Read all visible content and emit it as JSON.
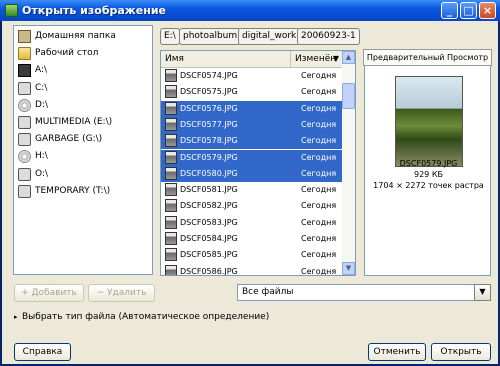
{
  "window": {
    "title": "Открыть изображение"
  },
  "places": [
    {
      "label": "Домашняя папка",
      "icon": "home-folder-icon"
    },
    {
      "label": "Рабочий стол",
      "icon": "desktop-folder-icon"
    },
    {
      "label": "A:\\",
      "icon": "floppy-icon"
    },
    {
      "label": "C:\\",
      "icon": "hard-disk-icon"
    },
    {
      "label": "D:\\",
      "icon": "cdrom-icon"
    },
    {
      "label": "MULTIMEDIA (E:\\)",
      "icon": "hard-disk-icon"
    },
    {
      "label": "GARBAGE (G:\\)",
      "icon": "hard-disk-icon"
    },
    {
      "label": "H:\\",
      "icon": "cdrom-icon"
    },
    {
      "label": "O:\\",
      "icon": "hard-disk-icon"
    },
    {
      "label": "TEMPORARY (T:\\)",
      "icon": "hard-disk-icon"
    }
  ],
  "path": [
    "E:\\",
    "photoalbum",
    "digital_work",
    "20060923-1"
  ],
  "files": {
    "header_name": "Имя",
    "header_modified": "Изменён",
    "rows": [
      {
        "name": "DSCF0574.JPG",
        "date": "Сегодня",
        "selected": false
      },
      {
        "name": "DSCF0575.JPG",
        "date": "Сегодня",
        "selected": false
      },
      {
        "name": "DSCF0576.JPG",
        "date": "Сегодня",
        "selected": true
      },
      {
        "name": "DSCF0577.JPG",
        "date": "Сегодня",
        "selected": true
      },
      {
        "name": "DSCF0578.JPG",
        "date": "Сегодня",
        "selected": true
      },
      {
        "name": "DSCF0579.JPG",
        "date": "Сегодня",
        "selected": true
      },
      {
        "name": "DSCF0580.JPG",
        "date": "Сегодня",
        "selected": true
      },
      {
        "name": "DSCF0581.JPG",
        "date": "Сегодня",
        "selected": false
      },
      {
        "name": "DSCF0582.JPG",
        "date": "Сегодня",
        "selected": false
      },
      {
        "name": "DSCF0583.JPG",
        "date": "Сегодня",
        "selected": false
      },
      {
        "name": "DSCF0584.JPG",
        "date": "Сегодня",
        "selected": false
      },
      {
        "name": "DSCF0585.JPG",
        "date": "Сегодня",
        "selected": false
      },
      {
        "name": "DSCF0586.JPG",
        "date": "Сегодня",
        "selected": false
      }
    ]
  },
  "preview": {
    "title": "Предварительный Просмотр",
    "filename": "DSCF0579.JPG",
    "size": "929 КБ",
    "dimensions": "1704 × 2272 точек растра"
  },
  "buttons": {
    "add": "Добавить",
    "remove": "Удалить",
    "help": "Справка",
    "cancel": "Отменить",
    "open": "Открыть"
  },
  "filter": {
    "value": "Все файлы"
  },
  "expander": {
    "label": "Выбрать тип файла (Автоматическое определение)"
  },
  "colors": {
    "selection": "#3168c9",
    "titlebar": "#0b57e3"
  }
}
